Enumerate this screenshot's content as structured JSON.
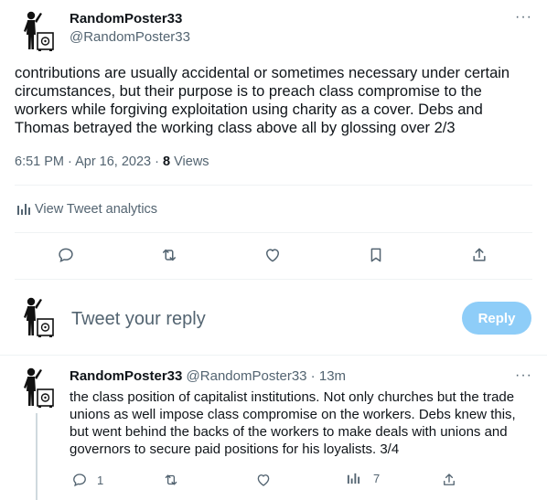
{
  "main_tweet": {
    "author_name": "RandomPoster33",
    "author_handle": "@RandomPoster33",
    "text": "contributions are usually accidental or sometimes necessary under certain circumstances, but their purpose is to preach class compromise to the workers while forgiving exploitation using charity as a cover. Debs and Thomas betrayed the working class above all by glossing over 2/3",
    "time": "6:51 PM · Apr 16, 2023 · ",
    "views_count": "8",
    "views_label": " Views",
    "analytics_label": "View Tweet analytics",
    "more_label": "···"
  },
  "actions": [
    "reply-icon",
    "retweet-icon",
    "like-icon",
    "bookmark-icon",
    "share-icon"
  ],
  "composer": {
    "placeholder": "Tweet your reply",
    "button_label": "Reply"
  },
  "reply_tweet": {
    "author_name": "RandomPoster33",
    "author_handle": "@RandomPoster33",
    "separator": " · ",
    "time": "13m",
    "text": "the class position of capitalist institutions. Not only churches but the trade unions as well impose class compromise on the workers. Debs knew this, but went behind the backs of the workers to make deals with unions and governors to secure paid positions for his loyalists. 3/4",
    "reply_count": "1",
    "views_count": "7",
    "more_label": "···"
  },
  "colors": {
    "accent": "#1d9bf0",
    "reply_button_disabled": "#8ecdf8",
    "secondary_text": "#536471",
    "divider": "#eff3f4"
  }
}
